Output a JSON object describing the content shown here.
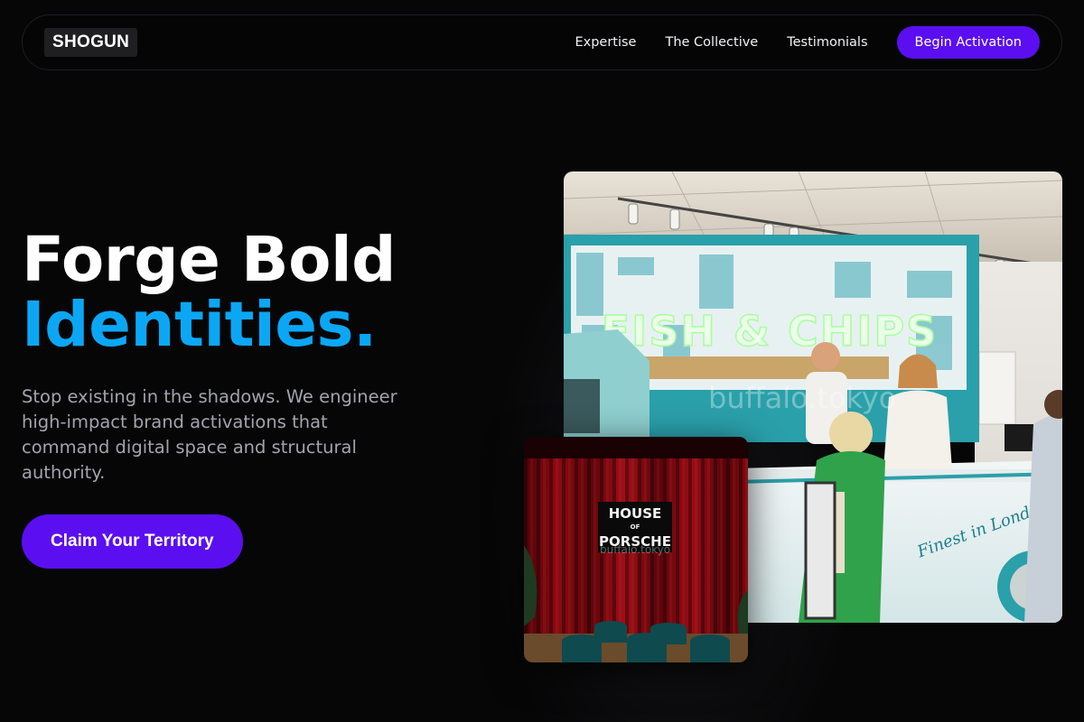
{
  "brand": {
    "logo": "SHOGUN"
  },
  "nav": {
    "links": [
      {
        "label": "Expertise"
      },
      {
        "label": "The Collective"
      },
      {
        "label": "Testimonials"
      }
    ],
    "cta_label": "Begin Activation"
  },
  "hero": {
    "headline_line1": "Forge Bold",
    "headline_line2": "Identities.",
    "subtitle": "Stop existing in the shadows. We engineer high-impact brand activations that command digital space and structural authority.",
    "cta_label": "Claim Your Territory"
  },
  "images": {
    "main": {
      "sign_text": "FISH & CHIPS",
      "van_text": "Finest in London!",
      "watermark": "buffalo.tokyo"
    },
    "secondary": {
      "sign_line1": "HOUSE",
      "sign_line2": "OF",
      "sign_line3": "PORSCHE",
      "watermark": "buffalo.tokyo"
    }
  },
  "colors": {
    "background": "#060607",
    "accent_purple": "#5b0ff0",
    "accent_blue": "#0ba7f5",
    "subtitle_gray": "#a3a3ae"
  }
}
